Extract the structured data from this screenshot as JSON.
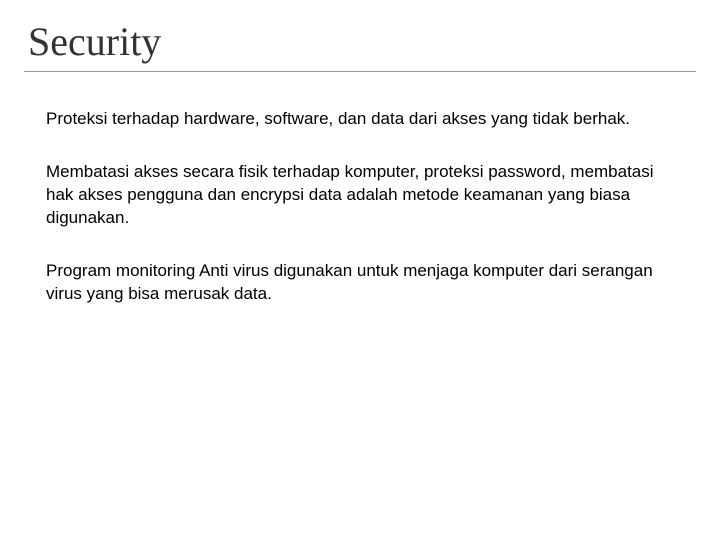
{
  "slide": {
    "title": "Security",
    "paragraphs": [
      "Proteksi terhadap hardware, software, dan data dari akses yang tidak berhak.",
      "Membatasi akses secara fisik terhadap komputer, proteksi password, membatasi hak akses pengguna dan encrypsi data adalah metode keamanan yang biasa digunakan.",
      "Program monitoring Anti virus digunakan untuk menjaga komputer dari serangan virus yang bisa merusak data."
    ]
  }
}
